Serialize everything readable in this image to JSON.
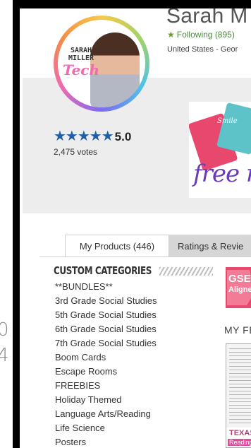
{
  "store": {
    "name": "Sarah M",
    "following_label": "Following",
    "following_count": "(895)",
    "location": "United States - Geor"
  },
  "avatar": {
    "logo_line1": "SARAH",
    "logo_line2": "MILLER",
    "logo_line3": "Tech"
  },
  "rating": {
    "stars": "★★★★★",
    "score": "5.0",
    "votes": "2,475 votes"
  },
  "banner": {
    "card1_text": "Smile",
    "free_text": "free r"
  },
  "tabs": [
    {
      "label": "My Products (446)",
      "active": true
    },
    {
      "label": "Ratings & Revie",
      "active": false
    }
  ],
  "categories": {
    "heading": "CUSTOM CATEGORIES",
    "items": [
      "**BUNDLES**",
      "3rd Grade Social Studies",
      "5th Grade Social Studies",
      "6th Grade Social Studies",
      "7th Grade Social Studies",
      "Boom Cards",
      "Escape Rooms",
      "FREEBIES",
      "Holiday Themed",
      "Language Arts/Reading",
      "Life Science",
      "Posters"
    ]
  },
  "featured": {
    "gse_line1": "GSE",
    "gse_line2": "Aligned",
    "heading": "MY FEA",
    "thumb_title": "TEXAS",
    "thumb_sub": "Reading &"
  },
  "margin": {
    "glyph_top": "0",
    "glyph_bottom": "4"
  },
  "colors": {
    "following_green": "#4a8a3a",
    "star_blue": "#1f5fa8",
    "band_gray": "#ededed",
    "tab_inactive_gray": "#d6d6d6",
    "gse_pink": "#e9486e"
  }
}
